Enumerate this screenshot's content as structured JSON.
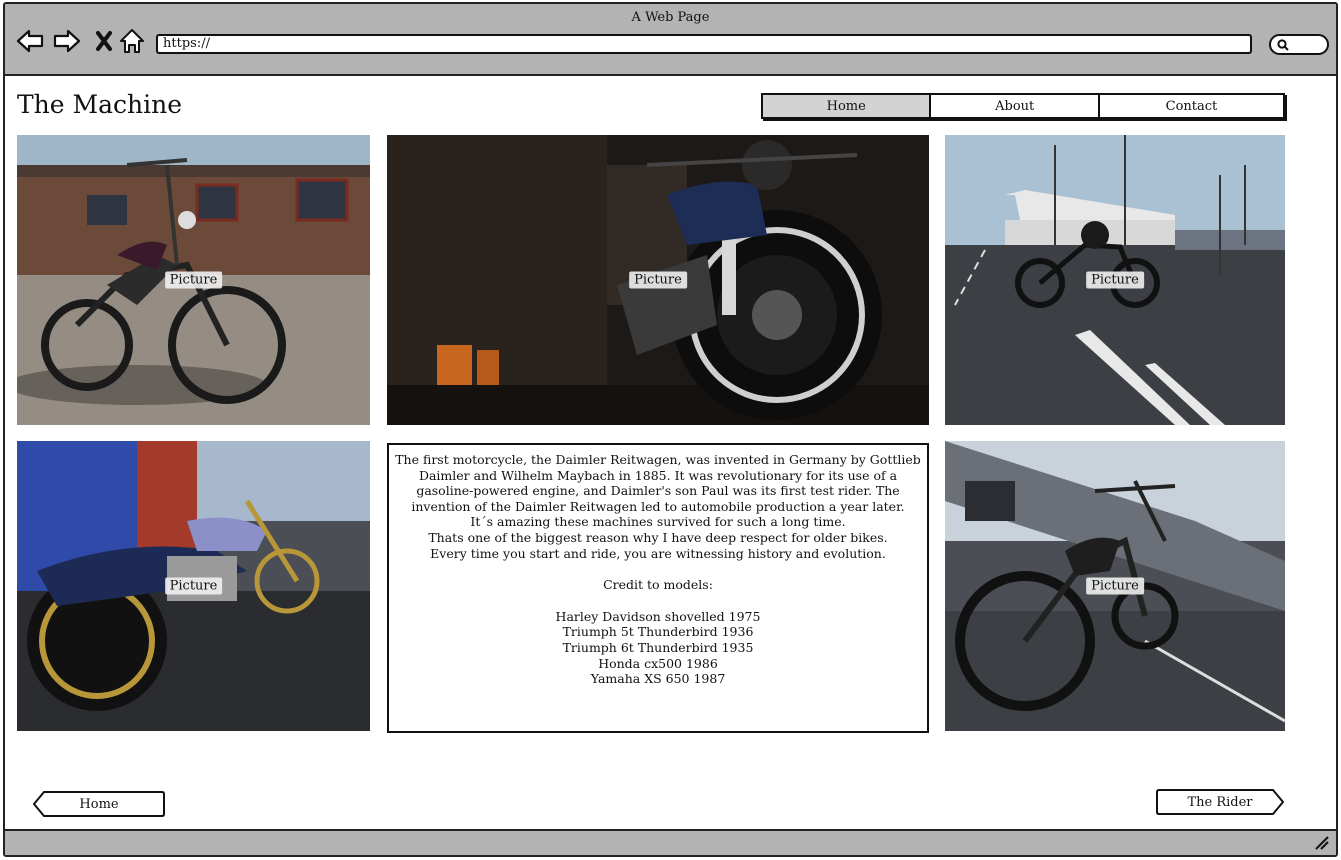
{
  "window": {
    "title": "A Web Page"
  },
  "browser": {
    "url": "https://",
    "icons": [
      "back-arrow-icon",
      "forward-arrow-icon",
      "close-x-icon",
      "home-icon",
      "search-icon"
    ]
  },
  "page": {
    "title": "The Machine",
    "tabs": [
      {
        "label": "Home",
        "active": true
      },
      {
        "label": "About",
        "active": false
      },
      {
        "label": "Contact",
        "active": false
      }
    ],
    "pictures": [
      {
        "label": "Picture"
      },
      {
        "label": "Picture"
      },
      {
        "label": "Picture"
      },
      {
        "label": "Picture"
      },
      {
        "label": "Picture"
      }
    ],
    "text": {
      "paragraph": [
        "The first motorcycle, the Daimler Reitwagen, was invented in Germany by Gottlieb",
        "Daimler and Wilhelm Maybach in 1885. It was revolutionary for its use of a",
        "gasoline-powered engine, and Daimler's son Paul was its first test rider. The",
        "invention of the Daimler Reitwagen led to automobile production a year later.",
        "It´s amazing these machines survived for such a long time.",
        "Thats one of the biggest reason why I have deep respect for older bikes.",
        "Every time you start and ride,  you are witnessing history and evolution."
      ],
      "credit_heading": "Credit to models:",
      "models": [
        "Harley Davidson shovelled 1975",
        "Triumph 5t Thunderbird 1936",
        "Triumph 6t Thunderbird 1935",
        "Honda cx500 1986",
        "Yamaha XS 650 1987"
      ]
    },
    "bottom_nav": {
      "prev_label": "Home",
      "next_label": "The Rider"
    }
  },
  "colors": {
    "chrome": "#b3b3b3",
    "active_tab": "#d3d3d3",
    "outline": "#111111"
  }
}
